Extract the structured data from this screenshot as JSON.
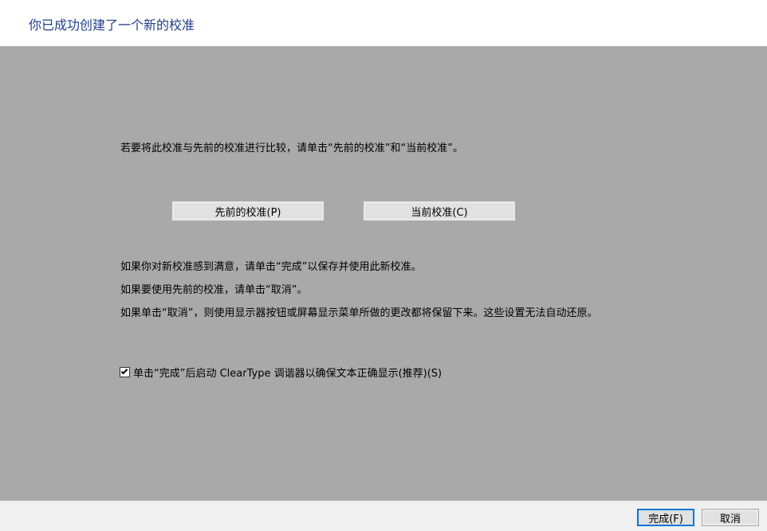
{
  "header": {
    "title": "你已成功创建了一个新的校准"
  },
  "main": {
    "instruction": "若要将此校准与先前的校准进行比较，请单击“先前的校准”和“当前校准”。",
    "previous_button_label": "先前的校准(P)",
    "current_button_label": "当前校准(C)",
    "info_lines": [
      "如果你对新校准感到满意，请单击“完成”以保存并使用此新校准。",
      "如果要使用先前的校准，请单击“取消”。",
      "如果单击“取消”，则使用显示器按钮或屏幕显示菜单所做的更改都将保留下来。这些设置无法自动还原。"
    ],
    "checkbox": {
      "label": "单击“完成”后启动 ClearType 调谐器以确保文本正确显示(推荐)(S)",
      "checked": true
    }
  },
  "footer": {
    "finish_label": "完成(F)",
    "cancel_label": "取消"
  },
  "colors": {
    "title": "#1f3f8c",
    "content_background": "#a9a9a9",
    "footer_background": "#f0f0f0",
    "default_button_border": "#0078d7"
  }
}
